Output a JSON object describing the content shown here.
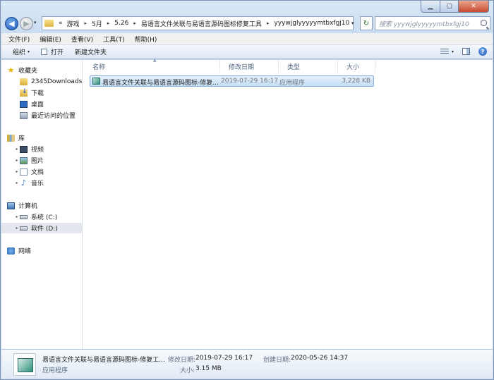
{
  "window_controls": {
    "minimize": "▁",
    "maximize": "▢",
    "close": "✕"
  },
  "nav": {
    "back": "◀",
    "forward": "▶",
    "dropdown": "▾"
  },
  "address": {
    "overflow": "«",
    "crumbs": [
      "游戏",
      "5月",
      "5.26",
      "易语言文件关联与易语言源码图标修复工具",
      "yyywjglyyyyymtbxfgj10"
    ],
    "separator": "▸",
    "dropdown": "▾",
    "refresh": "↻"
  },
  "search": {
    "placeholder": "搜索 yyywjglyyyyymtbxfgj10"
  },
  "menu": [
    "文件(F)",
    "编辑(E)",
    "查看(V)",
    "工具(T)",
    "帮助(H)"
  ],
  "toolbar": {
    "organize": "组织",
    "open": "打开",
    "new_folder": "新建文件夹",
    "caret": "▾",
    "help": "?"
  },
  "sidebar": {
    "favorites": {
      "label": "收藏夹",
      "items": [
        "2345Downloads",
        "下载",
        "桌面",
        "最近访问的位置"
      ]
    },
    "libraries": {
      "label": "库",
      "items": [
        "视频",
        "图片",
        "文档",
        "音乐"
      ]
    },
    "computer": {
      "label": "计算机",
      "items": [
        "系统 (C:)",
        "软件 (D:)"
      ]
    },
    "network": {
      "label": "网络"
    },
    "expander": "▸",
    "star": "★",
    "note": "♪"
  },
  "columns": {
    "name": "名称",
    "modified": "修改日期",
    "type": "类型",
    "size": "大小",
    "sort_arrow": "▲"
  },
  "files": [
    {
      "name": "易语言文件关联与易语言源码图标-修复...",
      "modified": "2019-07-29 16:17",
      "type": "应用程序",
      "size": "3,228 KB"
    }
  ],
  "details": {
    "name": "易语言文件关联与易语言源码图标-修复工...",
    "type": "应用程序",
    "modified_label": "修改日期:",
    "modified": "2019-07-29 16:17",
    "created_label": "创建日期:",
    "created": "2020-05-26 14:37",
    "size_label": "大小:",
    "size": "3.15 MB"
  }
}
